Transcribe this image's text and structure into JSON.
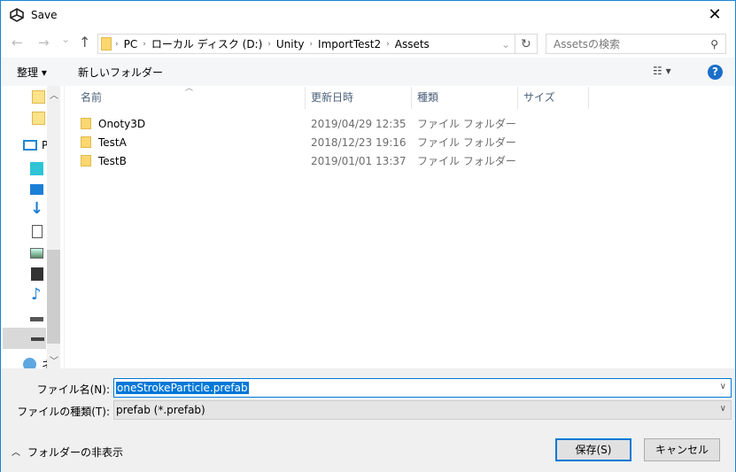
{
  "window": {
    "title": "Save",
    "close": "✕"
  },
  "nav": {
    "back": "←",
    "forward": "→",
    "recent": "⌄",
    "up": "↑",
    "refresh": "↻"
  },
  "address": {
    "segments": [
      "PC",
      "ローカル ディスク (D:)",
      "Unity",
      "ImportTest2",
      "Assets"
    ]
  },
  "search": {
    "placeholder": "Assetsの検索"
  },
  "toolbar": {
    "organize": "整理 ▾",
    "new_folder": "新しいフォルダー",
    "view": "☷ ▾",
    "help": "?"
  },
  "sidebar": {
    "items": [
      {
        "icon": "folder-icon"
      },
      {
        "icon": "folder-icon"
      },
      {
        "icon": "pc-icon",
        "label": "PC"
      },
      {
        "icon": "3d-objects-icon"
      },
      {
        "icon": "desktop-icon"
      },
      {
        "icon": "downloads-icon"
      },
      {
        "icon": "documents-icon"
      },
      {
        "icon": "pictures-icon"
      },
      {
        "icon": "videos-icon"
      },
      {
        "icon": "music-icon"
      },
      {
        "icon": "windows-drive-icon"
      },
      {
        "icon": "drive-icon",
        "selected": true
      },
      {
        "icon": "network-icon",
        "label": "ネットワーク"
      }
    ]
  },
  "columns": [
    "名前",
    "更新日時",
    "種類",
    "サイズ"
  ],
  "files": [
    {
      "name": "Onoty3D",
      "date": "2019/04/29 12:35",
      "type": "ファイル フォルダー"
    },
    {
      "name": "TestA",
      "date": "2018/12/23 19:16",
      "type": "ファイル フォルダー"
    },
    {
      "name": "TestB",
      "date": "2019/01/01 13:37",
      "type": "ファイル フォルダー"
    }
  ],
  "form": {
    "filename_label": "ファイル名(N):",
    "filename_value": "oneStrokeParticle.prefab",
    "type_label": "ファイルの種類(T):",
    "type_value": "prefab (*.prefab)"
  },
  "footer": {
    "hide_folders": "フォルダーの非表示",
    "save": "保存(S)",
    "cancel": "キャンセル"
  },
  "colors": {
    "accent": "#0078d7"
  }
}
